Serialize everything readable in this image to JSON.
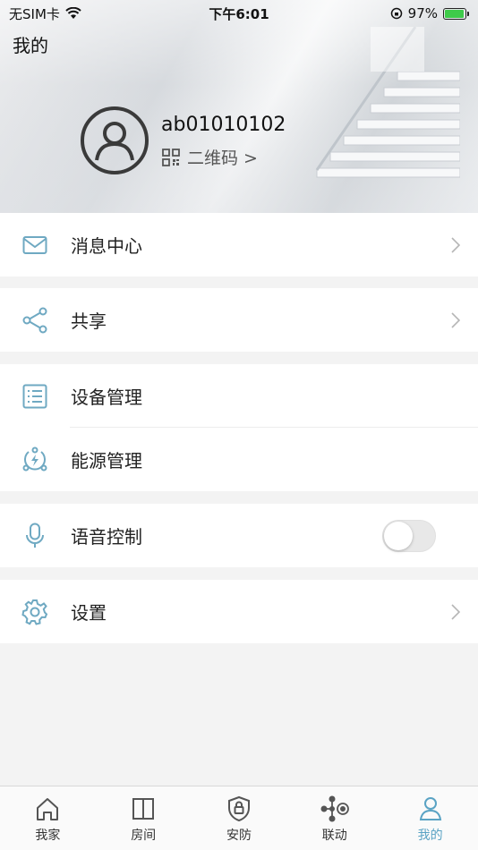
{
  "status_bar": {
    "carrier": "无SIM卡",
    "time": "下午6:01",
    "battery": "97%",
    "battery_level": 0.97
  },
  "header": {
    "title": "我的",
    "username": "ab01010102",
    "qr_label": "二维码 >"
  },
  "menu": {
    "messages": "消息中心",
    "share": "共享",
    "devices": "设备管理",
    "energy": "能源管理",
    "voice": "语音控制",
    "voice_enabled": false,
    "settings": "设置"
  },
  "tabs": [
    {
      "label": "我家",
      "icon": "home-icon"
    },
    {
      "label": "房间",
      "icon": "door-icon"
    },
    {
      "label": "安防",
      "icon": "shield-lock-icon"
    },
    {
      "label": "联动",
      "icon": "linkage-icon"
    },
    {
      "label": "我的",
      "icon": "user-icon",
      "active": true
    }
  ],
  "colors": {
    "accent": "#5aa3c4",
    "icon": "#6fa9c2"
  }
}
